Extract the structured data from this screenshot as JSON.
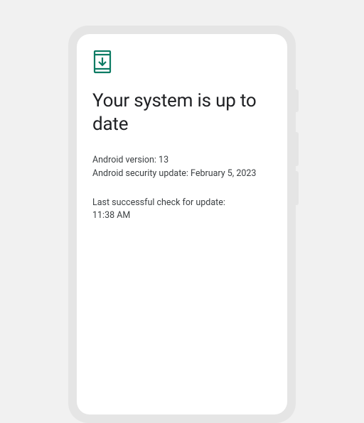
{
  "colors": {
    "accent": "#0b7b63"
  },
  "icon": "system-update-icon",
  "title": "Your system is up to date",
  "version_info": {
    "android_version_label": "Android version:",
    "android_version_value": "13",
    "security_update_label": "Android security update:",
    "security_update_value": "February 5, 2023"
  },
  "check_info": {
    "last_check_label": "Last successful check for update:",
    "last_check_time": "11:38 AM"
  }
}
